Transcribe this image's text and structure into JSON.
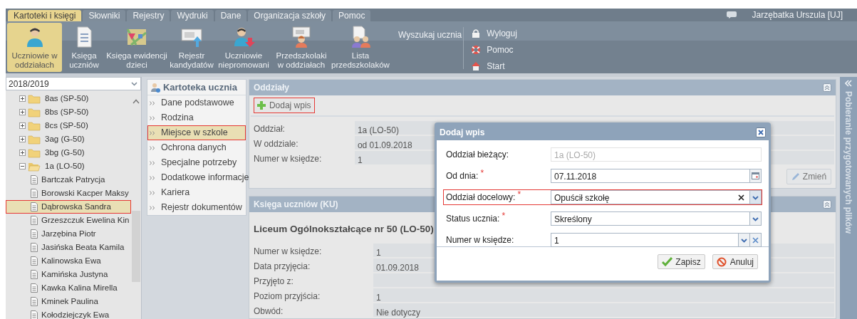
{
  "menu_tabs": [
    {
      "label": "Kartoteki i księgi",
      "selected": true
    },
    {
      "label": "Słowniki",
      "selected": false
    },
    {
      "label": "Rejestry",
      "selected": false
    },
    {
      "label": "Wydruki",
      "selected": false
    },
    {
      "label": "Dane",
      "selected": false
    },
    {
      "label": "Organizacja szkoły",
      "selected": false
    },
    {
      "label": "Pomoc",
      "selected": false
    }
  ],
  "user": "Jarzębatka Urszula [UJ]",
  "toolbar": [
    {
      "label": "Uczniowie w oddziałach",
      "selected": true
    },
    {
      "label": "Księga uczniów",
      "selected": false
    },
    {
      "label": "Księga ewidencji dzieci",
      "selected": false
    },
    {
      "label": "Rejestr kandydatów",
      "selected": false
    },
    {
      "label": "Uczniowie niepromowani",
      "selected": false
    },
    {
      "label": "Przedszkolaki w oddziałach",
      "selected": false
    },
    {
      "label": "Lista przedszkolaków",
      "selected": false
    }
  ],
  "search_link": "Wyszukaj ucznia",
  "session_links": [
    {
      "kind": "logout",
      "label": "Wyloguj"
    },
    {
      "kind": "help",
      "label": "Pomoc"
    },
    {
      "kind": "home",
      "label": "Start"
    }
  ],
  "tree": {
    "year": "2018/2019",
    "items": [
      {
        "label": "8as (SP-50)",
        "expanded": false,
        "selected": false,
        "outlined": false
      },
      {
        "label": "8bs (SP-50)",
        "expanded": false,
        "selected": false,
        "outlined": false
      },
      {
        "label": "8cs (SP-50)",
        "expanded": false,
        "selected": false,
        "outlined": false
      },
      {
        "label": "3ag (G-50)",
        "expanded": false,
        "selected": false,
        "outlined": false
      },
      {
        "label": "3bg (G-50)",
        "expanded": false,
        "selected": false,
        "outlined": false
      },
      {
        "label": "1a (LO-50)",
        "expanded": true,
        "selected": false,
        "outlined": false,
        "children": [
          {
            "label": "Bartczak Patrycja",
            "selected": false,
            "outlined": false
          },
          {
            "label": "Borowski Kacper Maksy",
            "selected": false,
            "outlined": false
          },
          {
            "label": "Dąbrowska Sandra",
            "selected": true,
            "outlined": true
          },
          {
            "label": "Grzeszczuk Ewelina Kin",
            "selected": false,
            "outlined": false
          },
          {
            "label": "Jarzębina Piotr",
            "selected": false,
            "outlined": false
          },
          {
            "label": "Jasińska Beata Kamila",
            "selected": false,
            "outlined": false
          },
          {
            "label": "Kalinowska Ewa",
            "selected": false,
            "outlined": false
          },
          {
            "label": "Kamińska Justyna",
            "selected": false,
            "outlined": false
          },
          {
            "label": "Kawka Kalina Mirella",
            "selected": false,
            "outlined": false
          },
          {
            "label": "Kminek Paulina",
            "selected": false,
            "outlined": false
          },
          {
            "label": "Kołodziejczyk Ewa",
            "selected": false,
            "outlined": false
          }
        ]
      }
    ]
  },
  "student_nav": {
    "title": "Kartoteka ucznia",
    "items": [
      {
        "label": "Dane podstawowe",
        "selected": false,
        "outlined": false
      },
      {
        "label": "Rodzina",
        "selected": false,
        "outlined": false
      },
      {
        "label": "Miejsce w szkole",
        "selected": true,
        "outlined": true
      },
      {
        "label": "Ochrona danych",
        "selected": false,
        "outlined": false
      },
      {
        "label": "Specjalne potrzeby",
        "selected": false,
        "outlined": false
      },
      {
        "label": "Dodatkowe informacje",
        "selected": false,
        "outlined": false
      },
      {
        "label": "Kariera",
        "selected": false,
        "outlined": false
      },
      {
        "label": "Rejestr dokumentów",
        "selected": false,
        "outlined": false
      }
    ]
  },
  "oddzialy": {
    "title": "Oddziały",
    "add_button": {
      "label": "Dodaj wpis",
      "outlined": true
    },
    "rows": [
      {
        "label": "Oddział:",
        "value": "1a (LO-50)"
      },
      {
        "label": "W oddziale:",
        "value": "od 01.09.2018"
      },
      {
        "label": "Numer w księdze:",
        "value": "1"
      }
    ],
    "change_button": "Zmień"
  },
  "ksiega": {
    "title": "Księga uczniów (KU)",
    "school": "Liceum Ogólnokształcące nr 50 (LO-50)",
    "rows": [
      {
        "label": "Numer w księdze:",
        "value": "1"
      },
      {
        "label": "Data przyjęcia:",
        "value": "01.09.2018"
      },
      {
        "label": "Przyjęto z:"
      },
      {
        "label": "Poziom przyjścia:",
        "value": "1"
      },
      {
        "label": "Obwód:",
        "value": "Nie dotyczy"
      }
    ]
  },
  "side_panel": "Pobieranie przygotowanych plików",
  "dialog": {
    "title": "Dodaj wpis",
    "fields": [
      {
        "kind": "readonly",
        "label": "Oddział bieżący:",
        "value": "1a (LO-50)",
        "outlined": false
      },
      {
        "kind": "date",
        "label": "Od dnia:",
        "required_mark": "*",
        "value": "07.11.2018",
        "outlined": false
      },
      {
        "kind": "combo",
        "label": "Oddział docelowy:",
        "required_mark": "*",
        "value": "Opuścił szkołę",
        "outlined": true
      },
      {
        "kind": "select",
        "label": "Status ucznia:",
        "required_mark": "*",
        "value": "Skreślony",
        "outlined": false
      },
      {
        "kind": "select-clear",
        "label": "Numer w księdze:",
        "value": "1",
        "outlined": false
      }
    ],
    "buttons": [
      {
        "kind": "save",
        "label": "Zapisz"
      },
      {
        "kind": "cancel",
        "label": "Anuluj"
      }
    ]
  }
}
